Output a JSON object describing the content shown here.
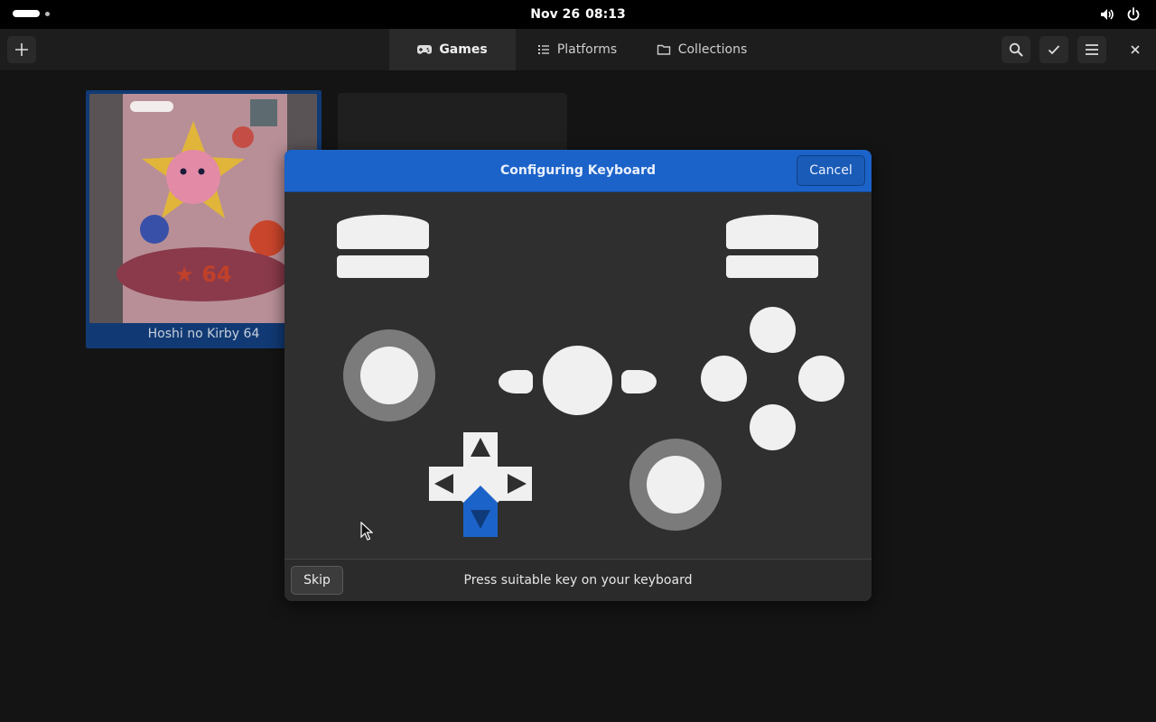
{
  "topbar": {
    "date": "Nov 26",
    "time": "08:13"
  },
  "header": {
    "tabs": [
      {
        "label": "Games",
        "icon": "gamepad-icon",
        "active": true
      },
      {
        "label": "Platforms",
        "icon": "list-icon",
        "active": false
      },
      {
        "label": "Collections",
        "icon": "folder-icon",
        "active": false
      }
    ]
  },
  "games": [
    {
      "title": "Hoshi no Kirby 64"
    }
  ],
  "dialog": {
    "title": "Configuring Keyboard",
    "cancel_label": "Cancel",
    "skip_label": "Skip",
    "status": "Press suitable key on your keyboard",
    "highlighted_input": "dpad-down",
    "accent_color": "#1c63c9"
  },
  "colors": {
    "accent": "#1c63c9",
    "background": "#141414",
    "dialog_bg": "#2f2f2f"
  }
}
